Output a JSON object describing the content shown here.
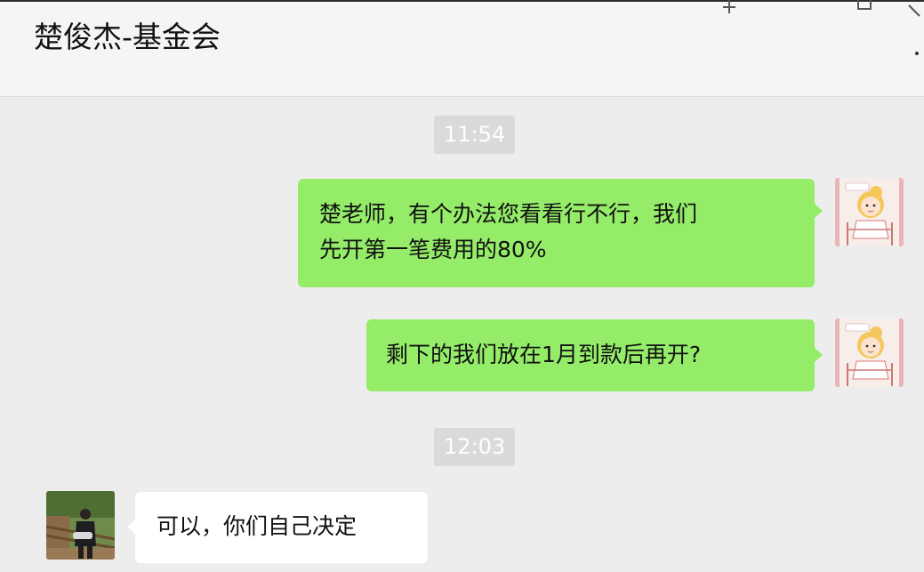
{
  "chat": {
    "title": "楚俊杰-基金会"
  },
  "window_controls": {
    "pin": "pin-icon",
    "maximize": "maximize-icon",
    "close": "close-icon",
    "more": "more-icon"
  },
  "messages": [
    {
      "type": "time",
      "text": "11:54"
    },
    {
      "type": "message",
      "side": "right",
      "lines": [
        "楚老师，有个办法您看看行不行，我们",
        "先开第一笔费用的80%"
      ]
    },
    {
      "type": "message",
      "side": "right",
      "lines": [
        "剩下的我们放在1月到款后再开?"
      ]
    },
    {
      "type": "time",
      "text": "12:03"
    },
    {
      "type": "message",
      "side": "left",
      "lines": [
        "可以，你们自己决定"
      ]
    }
  ],
  "colors": {
    "sent_bubble": "#95ec69",
    "received_bubble": "#ffffff",
    "background": "#ededed",
    "time_label": "#dadada"
  }
}
